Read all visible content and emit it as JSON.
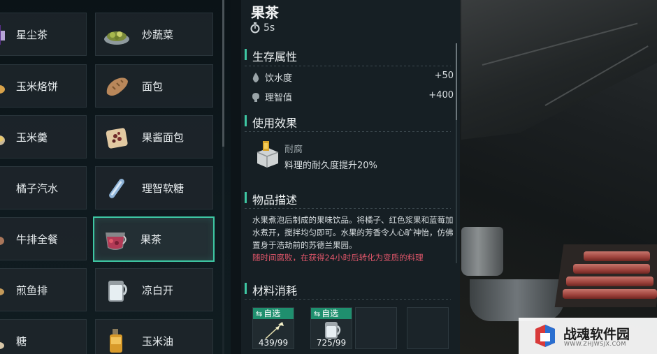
{
  "recipes": [
    {
      "id": "xingchencha",
      "name": "星尘茶",
      "selected": false
    },
    {
      "id": "chaoshucai",
      "name": "炒蔬菜",
      "selected": false
    },
    {
      "id": "yumilaobing",
      "name": "玉米烙饼",
      "selected": false
    },
    {
      "id": "mianbao",
      "name": "面包",
      "selected": false
    },
    {
      "id": "yumigeng",
      "name": "玉米羹",
      "selected": false
    },
    {
      "id": "guojiangmianbao",
      "name": "果酱面包",
      "selected": false
    },
    {
      "id": "juziqishui",
      "name": "橘子汽水",
      "selected": false
    },
    {
      "id": "lizhiruantang",
      "name": "理智软糖",
      "selected": false
    },
    {
      "id": "niupaiquancan",
      "name": "牛排全餐",
      "selected": false
    },
    {
      "id": "guocha",
      "name": "果茶",
      "selected": true
    },
    {
      "id": "jianyupai",
      "name": "煎鱼排",
      "selected": false
    },
    {
      "id": "liangbaikai",
      "name": "凉白开",
      "selected": false
    },
    {
      "id": "tang",
      "name": "糖",
      "selected": false
    },
    {
      "id": "yumiyou",
      "name": "玉米油",
      "selected": false
    }
  ],
  "detail": {
    "title": "果茶",
    "time": "5s",
    "sections": {
      "survival": "生存属性",
      "effect": "使用效果",
      "description": "物品描述",
      "materials": "材料消耗"
    },
    "stats": [
      {
        "label": "饮水度",
        "value": "+50",
        "icon": "water-drop-icon"
      },
      {
        "label": "理智值",
        "value": "+400",
        "icon": "brain-icon"
      }
    ],
    "effect": {
      "name": "耐腐",
      "desc": "料理的耐久度提升20%",
      "icon": "durability-box-icon"
    },
    "description": "水果煮泡后制成的果味饮品。将橘子、红色浆果和蓝莓加水煮开，搅拌均匀即可。水果的芳香令人心旷神怡，仿佛置身于浩劫前的苏德兰果园。",
    "warning": "随时间腐败，在获得24小时后转化为变质的料理",
    "materials": [
      {
        "tag": "自选",
        "count": "439/99",
        "icon": "herb-sprig-icon"
      },
      {
        "tag": "自选",
        "count": "725/99",
        "icon": "water-jar-icon"
      }
    ]
  },
  "colors": {
    "accent": "#3ec7a3",
    "tag_bg": "#1f8f6e",
    "warning": "#e0566a"
  },
  "watermark": {
    "name": "战魂软件园",
    "url": "WWW.ZHJWSJX.COM"
  }
}
